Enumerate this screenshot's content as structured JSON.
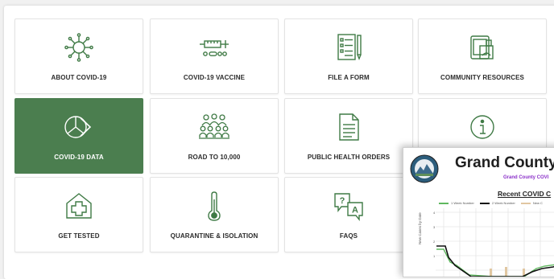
{
  "tiles": [
    {
      "label": "ABOUT COVID-19",
      "icon": "virus-icon"
    },
    {
      "label": "COVID-19 VACCINE",
      "icon": "syringe-icon"
    },
    {
      "label": "FILE A FORM",
      "icon": "form-icon"
    },
    {
      "label": "COMMUNITY RESOURCES",
      "icon": "community-resources-icon"
    },
    {
      "label": "COVID-19 DATA",
      "icon": "pie-chart-icon",
      "active": true
    },
    {
      "label": "ROAD TO 10,000",
      "icon": "group-icon"
    },
    {
      "label": "PUBLIC HEALTH ORDERS",
      "icon": "document-icon"
    },
    {
      "label": "",
      "icon": "info-icon"
    },
    {
      "label": "GET TESTED",
      "icon": "medical-cross-icon"
    },
    {
      "label": "QUARANTINE & ISOLATION",
      "icon": "thermometer-icon"
    },
    {
      "label": "FAQS",
      "icon": "faq-bubbles-icon"
    }
  ],
  "overlay": {
    "title": "Grand County",
    "subtitle": "Grand County COVI",
    "chart_title": "Recent COVID C",
    "legend": [
      "1 Week Number",
      "2 Week Number",
      "New C"
    ],
    "ylabel": "New Cases by Date",
    "yticks": [
      "4",
      "3",
      "2",
      "1"
    ]
  },
  "colors": {
    "accent_green": "#4b7e4f",
    "icon_green": "#3f7a45",
    "legend_green": "#5fb85f",
    "legend_black": "#111111",
    "legend_tan": "#e1c7a1"
  }
}
